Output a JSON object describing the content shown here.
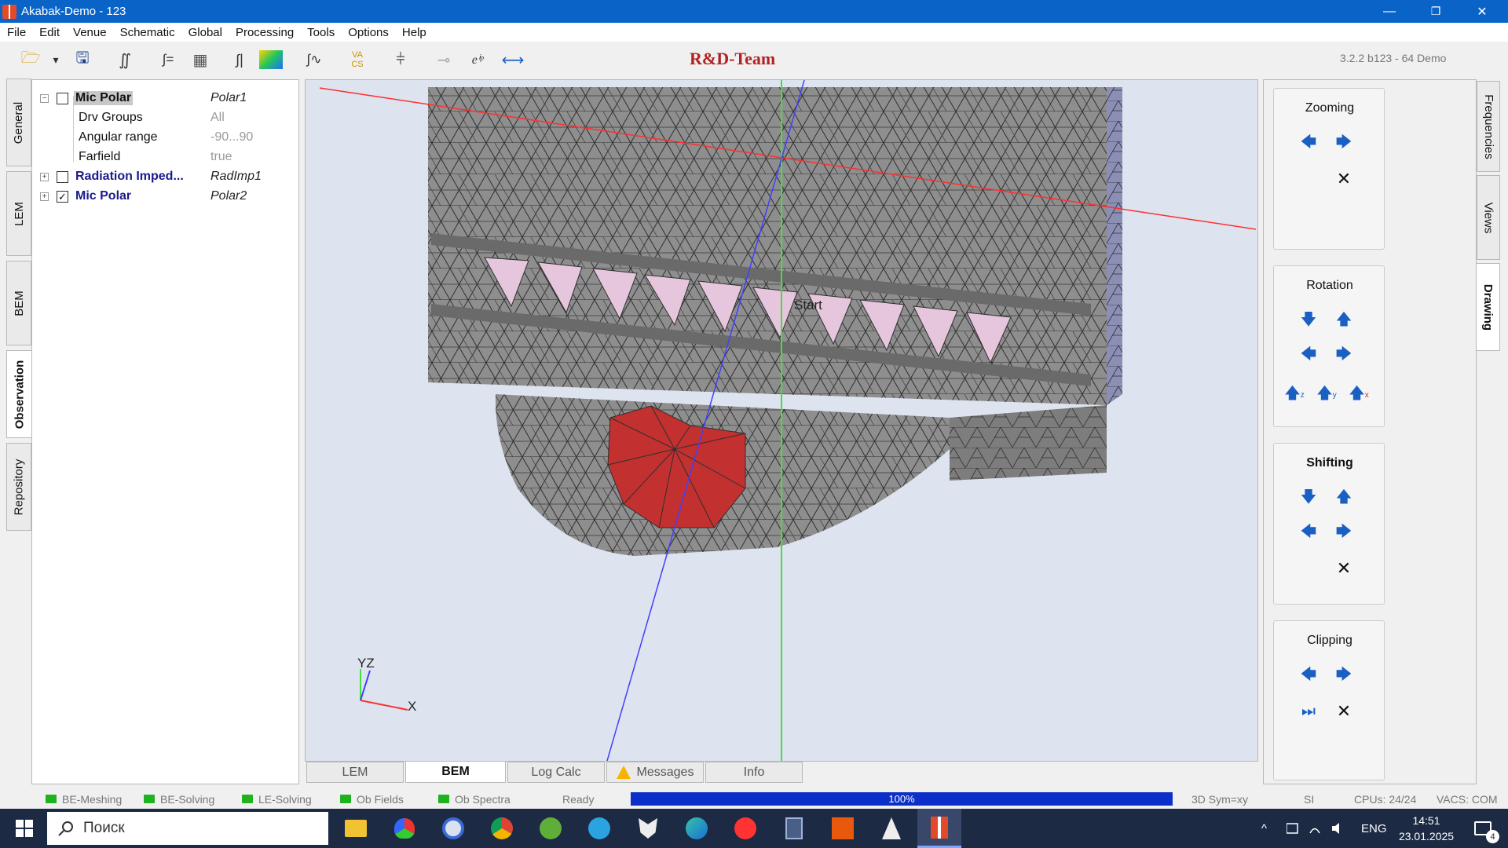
{
  "window": {
    "title": "Akabak-Demo - 123",
    "minimize": "—",
    "maximize": "❐",
    "close": "✕"
  },
  "menu": [
    "File",
    "Edit",
    "Venue",
    "Schematic",
    "Global",
    "Processing",
    "Tools",
    "Options",
    "Help"
  ],
  "toolbar": {
    "brand": "R&D-Team",
    "version": "3.2.2 b123 - 64 Demo",
    "icons": {
      "open": "🗁",
      "dropdown": "▾",
      "save": "🖫",
      "integral": "∬",
      "integral_eq": "∫=",
      "mesh": "▦",
      "integral_bars": "∫|",
      "gradient": "▩",
      "freq_plot": "∫∿",
      "va_cs": "VA/CS",
      "probe": "⫩",
      "point": "⊸",
      "complex": "eⁱᵖ",
      "arrows": "⟷"
    },
    "va_cs": {
      "top": "VA",
      "bottom": "CS"
    },
    "exp_label": "eⁱᵖ"
  },
  "left_tabs": [
    "General",
    "LEM",
    "BEM",
    "Observation",
    "Repository"
  ],
  "tree": {
    "items": [
      {
        "label": "Mic Polar",
        "value": "Polar1",
        "checked": false,
        "expanded": true
      },
      {
        "label": "Drv Groups",
        "value": "All"
      },
      {
        "label": "Angular range",
        "value": "-90...90"
      },
      {
        "label": "Farfield",
        "value": "true"
      },
      {
        "label": "Radiation Imped...",
        "value": "RadImp1",
        "checked": false,
        "expanded": false
      },
      {
        "label": "Mic Polar",
        "value": "Polar2",
        "checked": true,
        "expanded": false
      }
    ],
    "expand_minus": "−",
    "expand_plus": "+",
    "check_mark": "✓"
  },
  "viewport": {
    "annotation": "Start",
    "axis_labels": {
      "yz": "YZ",
      "x": "X"
    },
    "colors": {
      "background": "#dde4ef",
      "mesh": "#8e8e8e",
      "edge": "#2f2f2f",
      "side": "#8b8fb5",
      "highlight": "#c23030",
      "pink": "#e6c6dc",
      "red_axis": "#ff3030",
      "green_axis": "#40e040",
      "blue_axis": "#4040ff"
    }
  },
  "bottom_tabs": [
    "LEM",
    "BEM",
    "Log Calc",
    "Messages",
    "Info"
  ],
  "right_panel": {
    "zooming": {
      "title": "Zooming"
    },
    "rotation": {
      "title": "Rotation",
      "axes": [
        "z",
        "y",
        "x"
      ]
    },
    "shifting": {
      "title": "Shifting"
    },
    "clipping": {
      "title": "Clipping"
    },
    "glyphs": {
      "left": "🡄",
      "right": "🡆",
      "up": "🡅",
      "down": "🡇",
      "close": "✕",
      "skip": "⏭"
    }
  },
  "right_tabs": [
    "Frequencies",
    "Views",
    "Drawing"
  ],
  "status": {
    "leds": [
      "BE-Meshing",
      "BE-Solving",
      "LE-Solving",
      "Ob Fields",
      "Ob Spectra"
    ],
    "ready": "Ready",
    "progress": "100%",
    "progress_value": 1.0,
    "symmetry": "3D Sym=xy",
    "units": "SI",
    "cpus": "CPUs: 24/24",
    "vacs": "VACS: COM"
  },
  "taskbar": {
    "search_placeholder": "Поиск",
    "apps": [
      "file-explorer",
      "shield-app",
      "media-player",
      "chrome",
      "utorrent",
      "telegram",
      "wolf-app",
      "edge",
      "yandex-browser",
      "calculator",
      "far-manager",
      "sail-app",
      "akabak"
    ],
    "tray": {
      "chevron": "^",
      "lang": "ENG",
      "time": "14:51",
      "date": "23.01.2025",
      "notifications": "4"
    }
  }
}
